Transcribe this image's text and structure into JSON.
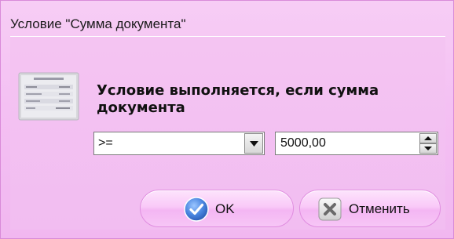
{
  "dialog": {
    "title": "Условие \"Сумма документа\"",
    "message": "Условие выполняется, если сумма документа"
  },
  "condition": {
    "operator": ">=",
    "amount": "5000,00"
  },
  "buttons": {
    "ok_label": "OK",
    "cancel_label": "Отменить"
  },
  "icons": {
    "main": "receipt-icon",
    "combo": "chevron-down-icon",
    "ok": "check-icon",
    "cancel": "close-icon"
  },
  "colors": {
    "background": "#f4c4f2",
    "button": "#f9c9f8",
    "ok_icon": "#3a78d8",
    "cancel_icon": "#6a6a6a"
  }
}
